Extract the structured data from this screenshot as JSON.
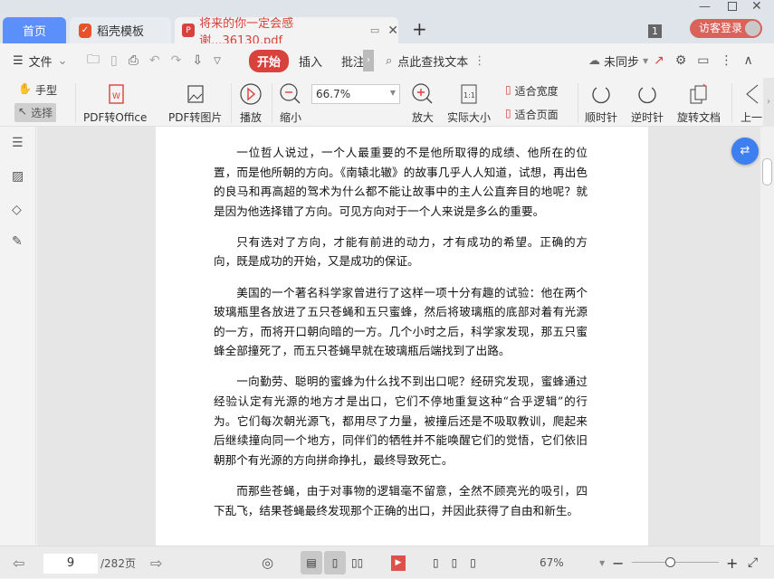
{
  "tabs": [
    {
      "label": "首页",
      "active": false
    },
    {
      "label": "稻壳模板"
    },
    {
      "label": "将来的你一定会感谢...36130.pdf",
      "active": true
    }
  ],
  "window": {
    "badge": "1",
    "login": "访客登录"
  },
  "toolbar": {
    "file": "文件",
    "start": "开始",
    "insert": "插入",
    "annotate": "批注",
    "search": "点此查找文本",
    "sync": "未同步"
  },
  "ribbon": {
    "hand": "手型",
    "select": "选择",
    "pdf_office": "PDF转Office",
    "pdf_image": "PDF转图片",
    "play": "播放",
    "zoom_out": "缩小",
    "zoom_value": "66.7%",
    "zoom_in": "放大",
    "actual": "实际大小",
    "fit_width": "适合宽度",
    "fit_page": "适合页面",
    "cw": "顺时针",
    "ccw": "逆时针",
    "rotate": "旋转文档",
    "prev": "上一"
  },
  "document": {
    "paragraphs": [
      "一位哲人说过，一个人最重要的不是他所取得的成绩、他所在的位置，而是他所朝的方向。《南辕北辙》的故事几乎人人知道，试想，再出色的良马和再高超的驾术为什么都不能让故事中的主人公直奔目的地呢？就是因为他选择错了方向。可见方向对于一个人来说是多么的重要。",
      "只有选对了方向，才能有前进的动力，才有成功的希望。正确的方向，既是成功的开始，又是成功的保证。",
      "美国的一个著名科学家曾进行了这样一项十分有趣的试验：他在两个玻璃瓶里各放进了五只苍蝇和五只蜜蜂，然后将玻璃瓶的底部对着有光源的一方，而将开口朝向暗的一方。几个小时之后，科学家发现，那五只蜜蜂全部撞死了，而五只苍蝇早就在玻璃瓶后端找到了出路。",
      "一向勤劳、聪明的蜜蜂为什么找不到出口呢？经研究发现，蜜蜂通过经验认定有光源的地方才是出口，它们不停地重复这种“合乎逻辑”的行为。它们每次朝光源飞，都用尽了力量，被撞后还是不吸取教训，爬起来后继续撞向同一个地方，同伴们的牺牲并不能唤醒它们的觉悟，它们依旧朝那个有光源的方向拼命挣扎，最终导致死亡。",
      "而那些苍蝇，由于对事物的逻辑毫不留意，全然不顾亮光的吸引，四下乱飞，结果苍蝇最终发现那个正确的出口，并因此获得了自由和新生。"
    ]
  },
  "status": {
    "page": "9",
    "total": "/282页",
    "zoom": "67%",
    "zoom_slider_percent": 45
  },
  "colors": {
    "accent": "#d9413c",
    "home_tab": "#5b8ff9",
    "float_button": "#3d7ff0"
  }
}
